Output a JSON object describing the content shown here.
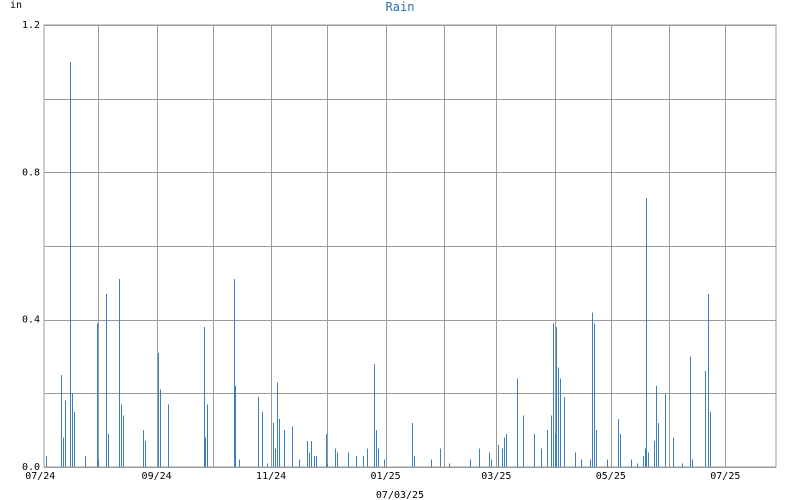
{
  "chart_data": {
    "type": "bar",
    "title": "Rain",
    "ylabel": "in",
    "xlabel": "07/03/25",
    "ylim": [
      0,
      1.2
    ],
    "xlim": [
      "2024-07-03",
      "2025-07-28"
    ],
    "grid": true,
    "bar_color": "#3c7fc0",
    "title_color": "#2a6fb0",
    "y_ticks": [
      {
        "value": 0.0,
        "label": "0.0"
      },
      {
        "value": 0.4,
        "label": "0.4"
      },
      {
        "value": 0.8,
        "label": "0.8"
      },
      {
        "value": 1.2,
        "label": "1.2"
      }
    ],
    "y_grid": [
      0,
      0.2,
      0.4,
      0.6,
      0.8,
      1.0,
      1.2
    ],
    "x_ticks": [
      {
        "date": "2024-07-01",
        "label": "07/24"
      },
      {
        "date": "2024-09-01",
        "label": "09/24"
      },
      {
        "date": "2024-11-01",
        "label": "11/24"
      },
      {
        "date": "2025-01-01",
        "label": "01/25"
      },
      {
        "date": "2025-03-01",
        "label": "03/25"
      },
      {
        "date": "2025-05-01",
        "label": "05/25"
      },
      {
        "date": "2025-07-01",
        "label": "07/25"
      }
    ],
    "x_grid": [
      "2024-07-01",
      "2024-08-01",
      "2024-09-01",
      "2024-10-01",
      "2024-11-01",
      "2024-12-01",
      "2025-01-01",
      "2025-02-01",
      "2025-03-01",
      "2025-04-01",
      "2025-05-01",
      "2025-06-01",
      "2025-07-01"
    ],
    "series": [
      {
        "x": [
          "2024-07-04",
          "2024-07-12",
          "2024-07-13",
          "2024-07-14",
          "2024-07-17",
          "2024-07-18",
          "2024-07-19",
          "2024-07-25",
          "2024-07-31",
          "2024-08-01",
          "2024-08-05",
          "2024-08-06",
          "2024-08-12",
          "2024-08-13",
          "2024-08-14",
          "2024-08-25",
          "2024-08-26",
          "2024-09-02",
          "2024-09-03",
          "2024-09-07",
          "2024-09-26",
          "2024-09-27",
          "2024-09-28",
          "2024-10-12",
          "2024-10-13",
          "2024-10-15",
          "2024-10-25",
          "2024-10-27",
          "2024-10-30",
          "2024-11-02",
          "2024-11-03",
          "2024-11-04",
          "2024-11-05",
          "2024-11-08",
          "2024-11-12",
          "2024-11-16",
          "2024-11-20",
          "2024-11-21",
          "2024-11-22",
          "2024-11-24",
          "2024-11-25",
          "2024-11-30",
          "2024-12-01",
          "2024-12-05",
          "2024-12-06",
          "2024-12-12",
          "2024-12-16",
          "2024-12-20",
          "2024-12-22",
          "2024-12-26",
          "2024-12-27",
          "2024-12-28",
          "2024-12-31",
          "2025-01-15",
          "2025-01-16",
          "2025-01-25",
          "2025-01-30",
          "2025-02-04",
          "2025-02-15",
          "2025-02-20",
          "2025-02-25",
          "2025-02-26",
          "2025-03-02",
          "2025-03-04",
          "2025-03-05",
          "2025-03-06",
          "2025-03-12",
          "2025-03-15",
          "2025-03-21",
          "2025-03-25",
          "2025-03-28",
          "2025-03-30",
          "2025-03-31",
          "2025-04-01",
          "2025-04-02",
          "2025-04-03",
          "2025-04-04",
          "2025-04-06",
          "2025-04-12",
          "2025-04-15",
          "2025-04-20",
          "2025-04-21",
          "2025-04-22",
          "2025-04-23",
          "2025-04-29",
          "2025-05-05",
          "2025-05-06",
          "2025-05-12",
          "2025-05-15",
          "2025-05-18",
          "2025-05-19",
          "2025-05-20",
          "2025-05-21",
          "2025-05-24",
          "2025-05-25",
          "2025-05-26",
          "2025-05-30",
          "2025-06-03",
          "2025-06-08",
          "2025-06-12",
          "2025-06-13",
          "2025-06-20",
          "2025-06-22",
          "2025-06-23"
        ],
        "values": [
          0.03,
          0.25,
          0.08,
          0.18,
          1.1,
          0.2,
          0.15,
          0.03,
          0.39,
          0.02,
          0.47,
          0.09,
          0.51,
          0.17,
          0.14,
          0.1,
          0.07,
          0.31,
          0.21,
          0.17,
          0.38,
          0.08,
          0.17,
          0.51,
          0.22,
          0.02,
          0.19,
          0.15,
          0.01,
          0.12,
          0.05,
          0.23,
          0.13,
          0.1,
          0.11,
          0.02,
          0.07,
          0.04,
          0.07,
          0.03,
          0.03,
          0.09,
          0.01,
          0.05,
          0.04,
          0.04,
          0.03,
          0.03,
          0.05,
          0.28,
          0.1,
          0.05,
          0.02,
          0.12,
          0.03,
          0.02,
          0.05,
          0.01,
          0.02,
          0.05,
          0.04,
          0.02,
          0.06,
          0.05,
          0.08,
          0.09,
          0.24,
          0.14,
          0.09,
          0.05,
          0.1,
          0.14,
          0.39,
          0.09,
          0.38,
          0.27,
          0.24,
          0.19,
          0.04,
          0.02,
          0.02,
          0.42,
          0.39,
          0.1,
          0.02,
          0.13,
          0.09,
          0.02,
          0.01,
          0.03,
          0.05,
          0.73,
          0.04,
          0.07,
          0.22,
          0.12,
          0.2,
          0.08,
          0.01,
          0.3,
          0.02,
          0.26,
          0.47,
          0.15
        ]
      }
    ]
  }
}
